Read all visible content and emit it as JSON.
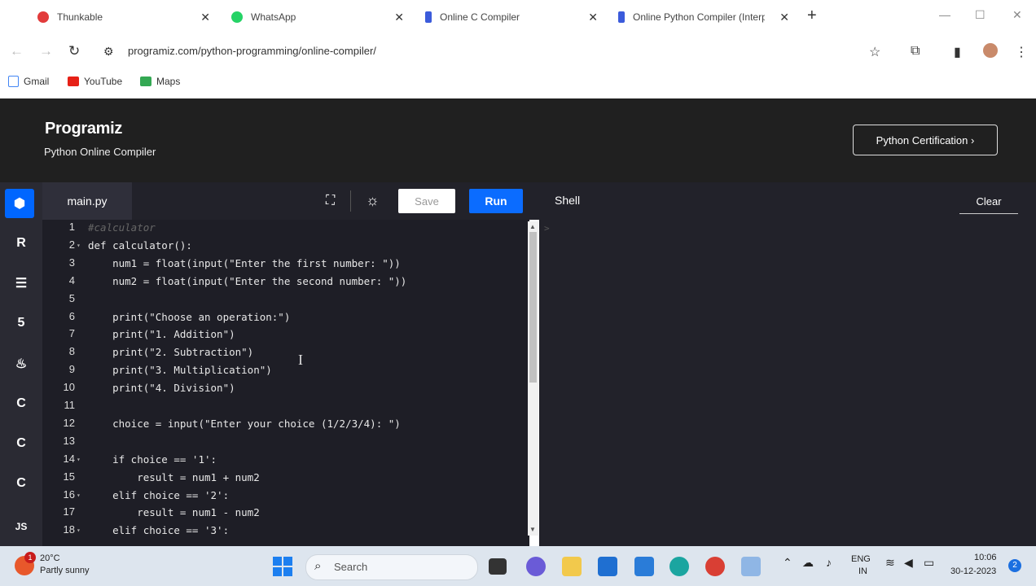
{
  "browser": {
    "tabs": [
      {
        "label": "Thunkable",
        "color": "#e23b3b"
      },
      {
        "label": "WhatsApp",
        "color": "#25d366"
      },
      {
        "label": "Online C Compiler",
        "color": "#3b5bdb"
      },
      {
        "label": "Online Python Compiler (Interp",
        "color": "#3b5bdb"
      }
    ],
    "close_glyph": "✕",
    "new_tab_glyph": "+",
    "url": "programiz.com/python-programming/online-compiler/",
    "bookmarks": [
      {
        "label": "Gmail",
        "icon": "gmail-icon"
      },
      {
        "label": "YouTube",
        "icon": "youtube-icon"
      },
      {
        "label": "Maps",
        "icon": "maps-icon"
      }
    ]
  },
  "site": {
    "logo": "Programiz",
    "subtitle": "Python Online Compiler",
    "cert_button": "Python Certification ›"
  },
  "sidebar": {
    "items": [
      {
        "name": "python-icon",
        "glyph": "⬢",
        "active": true
      },
      {
        "name": "r-icon",
        "glyph": "R"
      },
      {
        "name": "sql-icon",
        "glyph": "☰"
      },
      {
        "name": "html5-icon",
        "glyph": "5"
      },
      {
        "name": "java-icon",
        "glyph": "♨"
      },
      {
        "name": "c-icon",
        "glyph": "C"
      },
      {
        "name": "cpp-icon",
        "glyph": "C"
      },
      {
        "name": "csharp-icon",
        "glyph": "C"
      },
      {
        "name": "js-icon",
        "glyph": "JS"
      }
    ]
  },
  "editor": {
    "filename": "main.py",
    "save_label": "Save",
    "run_label": "Run",
    "shell_label": "Shell",
    "clear_label": "Clear",
    "shell_prompt": ">",
    "lines": [
      {
        "n": "1",
        "text": "#calculator",
        "comment": true
      },
      {
        "n": "2",
        "text": "def calculator():",
        "fold": true
      },
      {
        "n": "3",
        "text": "    num1 = float(input(\"Enter the first number: \"))"
      },
      {
        "n": "4",
        "text": "    num2 = float(input(\"Enter the second number: \"))"
      },
      {
        "n": "5",
        "text": ""
      },
      {
        "n": "6",
        "text": "    print(\"Choose an operation:\")"
      },
      {
        "n": "7",
        "text": "    print(\"1. Addition\")"
      },
      {
        "n": "8",
        "text": "    print(\"2. Subtraction\")"
      },
      {
        "n": "9",
        "text": "    print(\"3. Multiplication\")"
      },
      {
        "n": "10",
        "text": "    print(\"4. Division\")"
      },
      {
        "n": "11",
        "text": ""
      },
      {
        "n": "12",
        "text": "    choice = input(\"Enter your choice (1/2/3/4): \")"
      },
      {
        "n": "13",
        "text": ""
      },
      {
        "n": "14",
        "text": "    if choice == '1':",
        "fold": true
      },
      {
        "n": "15",
        "text": "        result = num1 + num2"
      },
      {
        "n": "16",
        "text": "    elif choice == '2':",
        "fold": true
      },
      {
        "n": "17",
        "text": "        result = num1 - num2"
      },
      {
        "n": "18",
        "text": "    elif choice == '3':",
        "fold": true
      }
    ]
  },
  "taskbar": {
    "temperature": "20°C",
    "condition": "Partly sunny",
    "weather_badge": "1",
    "search_placeholder": "Search",
    "lang_line1": "ENG",
    "lang_line2": "IN",
    "time": "10:06",
    "date": "30-12-2023",
    "notification_count": "2"
  }
}
